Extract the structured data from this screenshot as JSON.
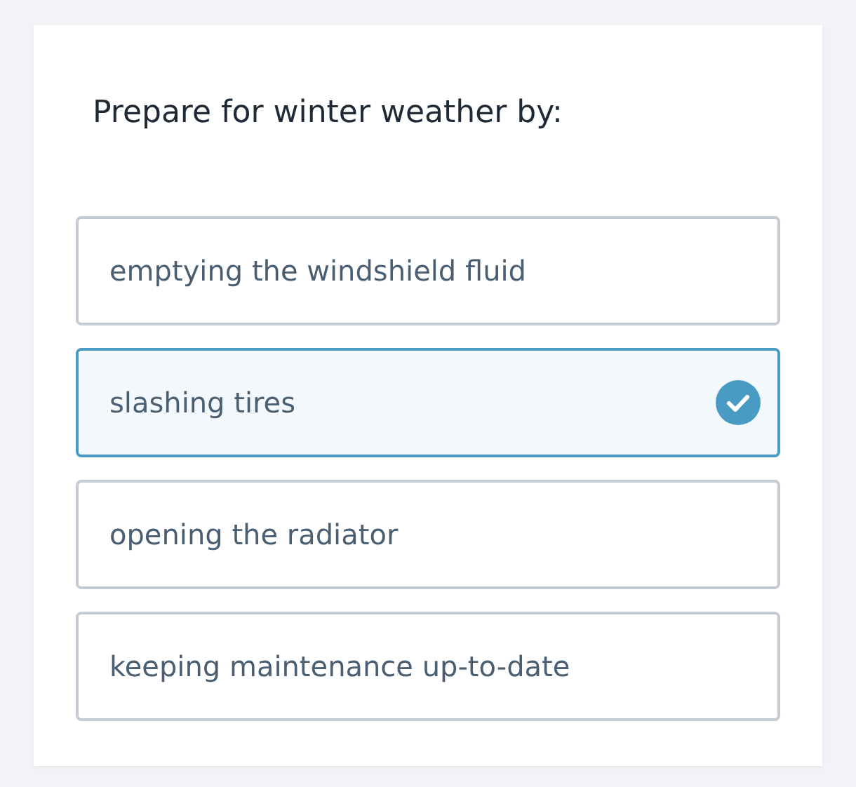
{
  "question": "Prepare for winter weather by:",
  "options": [
    {
      "label": "emptying the windshield fluid",
      "selected": false
    },
    {
      "label": "slashing tires",
      "selected": true
    },
    {
      "label": "opening the radiator",
      "selected": false
    },
    {
      "label": "keeping maintenance up-to-date",
      "selected": false
    }
  ]
}
